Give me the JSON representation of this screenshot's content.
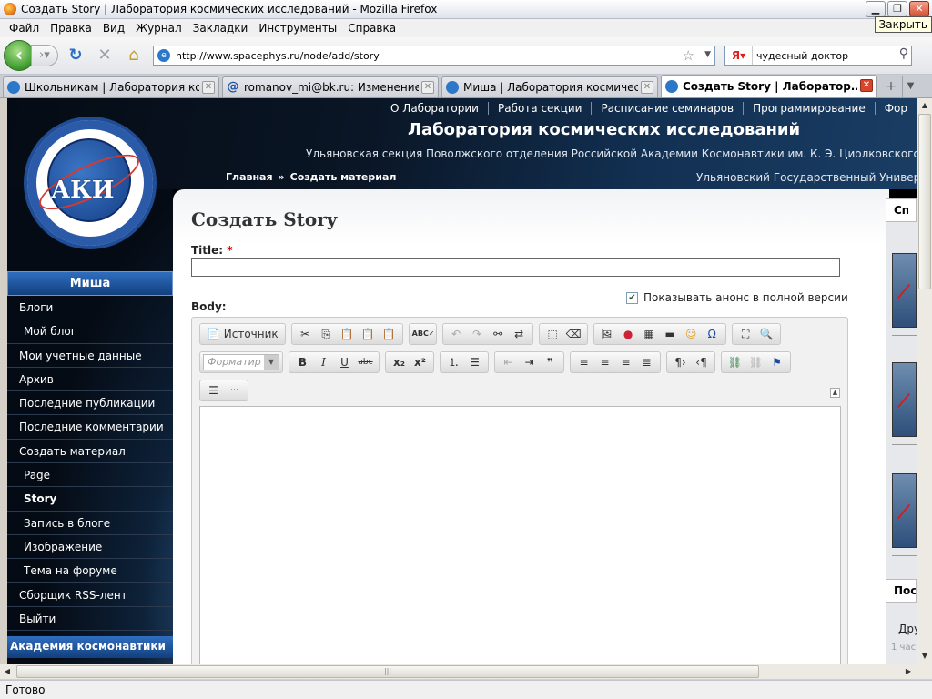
{
  "window": {
    "title": "Создать Story | Лаборатория космических исследований - Mozilla Firefox",
    "tooltip": "Закрыть"
  },
  "menu": [
    "Файл",
    "Правка",
    "Вид",
    "Журнал",
    "Закладки",
    "Инструменты",
    "Справка"
  ],
  "nav": {
    "url": "http://www.spacephys.ru/node/add/story",
    "search_value": "чудесный доктор",
    "search_engine_label": "Я"
  },
  "tabs": [
    {
      "label": "Школьникам | Лаборатория кос...",
      "active": false
    },
    {
      "label": "romanov_mi@bk.ru: Изменение ...",
      "active": false
    },
    {
      "label": "Миша | Лаборатория космическ...",
      "active": false
    },
    {
      "label": "Создать Story | Лаборатор...",
      "active": true
    }
  ],
  "site": {
    "topnav": [
      "О Лаборатории",
      "Работа секции",
      "Расписание семинаров",
      "Программирование",
      "Фор"
    ],
    "title": "Лаборатория космических исследований",
    "subtitle": "Ульяновская секция Поволжского отделения Российской Академии Космонавтики им. К. Э. Циолковского",
    "breadcrumb": [
      "Главная",
      "»",
      "Создать материал"
    ],
    "university": "Ульяновский Государственный Универс",
    "logo_text": "АКИ"
  },
  "sidebar": {
    "header": "Миша",
    "items": [
      {
        "label": "Блоги",
        "sub": false,
        "active": false
      },
      {
        "label": "Мой блог",
        "sub": true,
        "active": false
      },
      {
        "label": "Мои учетные данные",
        "sub": false,
        "active": false
      },
      {
        "label": "Архив",
        "sub": false,
        "active": false
      },
      {
        "label": "Последние публикации",
        "sub": false,
        "active": false
      },
      {
        "label": "Последние комментарии",
        "sub": false,
        "active": false
      },
      {
        "label": "Создать материал",
        "sub": false,
        "active": false
      },
      {
        "label": "Page",
        "sub": true,
        "active": false
      },
      {
        "label": "Story",
        "sub": true,
        "active": true
      },
      {
        "label": "Запись в блоге",
        "sub": true,
        "active": false
      },
      {
        "label": "Изображение",
        "sub": true,
        "active": false
      },
      {
        "label": "Тема на форуме",
        "sub": true,
        "active": false
      },
      {
        "label": "Сборщик RSS-лент",
        "sub": false,
        "active": false
      },
      {
        "label": "Выйти",
        "sub": false,
        "active": false
      }
    ],
    "footer": "Академия космонавтики"
  },
  "form": {
    "page_title": "Создать Story",
    "title_label": "Title:",
    "required_mark": "*",
    "body_label": "Body:",
    "teaser_label": "Показывать анонс в полной версии",
    "teaser_checked": true,
    "editor": {
      "source_label": "Источник",
      "format_placeholder": "Форматир"
    }
  },
  "right": {
    "tab1": "Сп",
    "tab2": "Пос",
    "text1": "Дру",
    "text2": "1 час"
  },
  "status": "Готово"
}
